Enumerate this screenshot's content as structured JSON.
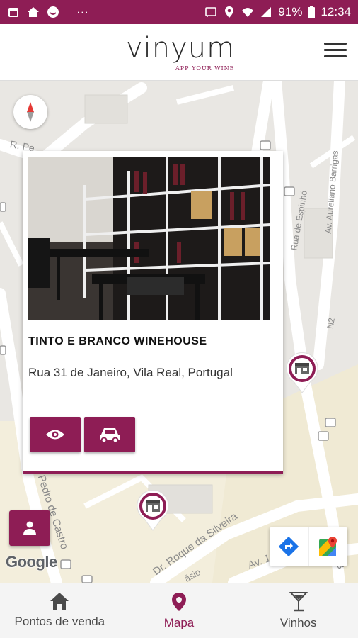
{
  "status_bar": {
    "battery": "91%",
    "time": "12:34",
    "dots": "···"
  },
  "header": {
    "logo_text": "vinyum",
    "tagline": "APP YOUR WINE"
  },
  "map": {
    "streets": [
      "R. Pe",
      "Rua de Espinhó",
      "Av. Aureliano Barrigas",
      "N2",
      "Pedro de Castro",
      "Dr. Roque da Silveira",
      "Av. 1",
      "ásio",
      "3"
    ],
    "google_label": "Google"
  },
  "place_card": {
    "name": "TINTO E BRANCO WINEHOUSE",
    "address": "Rua 31 de Janeiro, Vila Real, Portugal"
  },
  "bottom_nav": {
    "tabs": [
      {
        "label": "Pontos de venda",
        "icon": "home-icon",
        "active": false
      },
      {
        "label": "Mapa",
        "icon": "map-pin-icon",
        "active": true
      },
      {
        "label": "Vinhos",
        "icon": "wine-glass-icon",
        "active": false
      }
    ]
  },
  "colors": {
    "brand": "#8e1d55",
    "map_bg": "#e9e7e3",
    "road": "#ffffff"
  }
}
